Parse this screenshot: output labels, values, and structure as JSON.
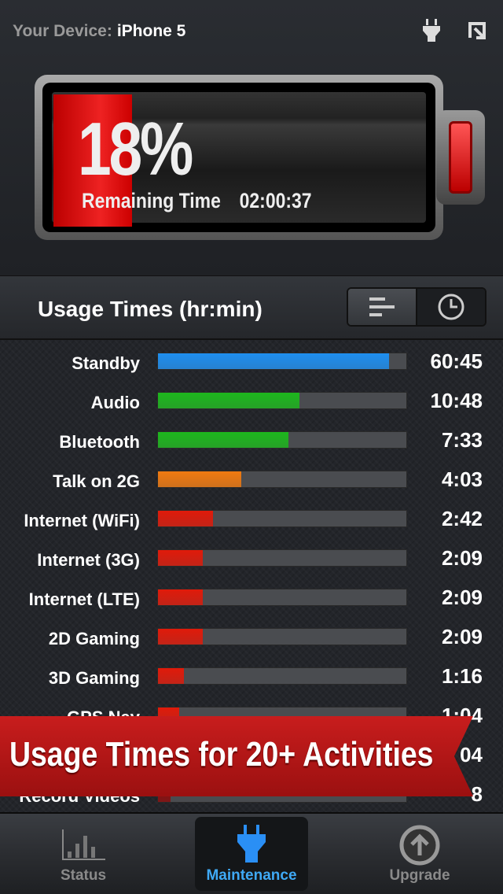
{
  "header": {
    "device_label": "Your Device:",
    "device_name": "iPhone 5"
  },
  "battery": {
    "percent_text": "18%",
    "percent": 18,
    "remaining_label": "Remaining Time",
    "remaining_value": "02:00:37",
    "color": "#e01818"
  },
  "usage": {
    "title": "Usage Times (hr:min)",
    "rows": [
      {
        "label": "Standby",
        "value": "60:45",
        "fill": 0.93,
        "color": "#1e8ff0"
      },
      {
        "label": "Audio",
        "value": "10:48",
        "fill": 0.57,
        "color": "#1db71d"
      },
      {
        "label": "Bluetooth",
        "value": "7:33",
        "fill": 0.525,
        "color": "#1db71d"
      },
      {
        "label": "Talk on 2G",
        "value": "4:03",
        "fill": 0.336,
        "color": "#f07a10"
      },
      {
        "label": "Internet (WiFi)",
        "value": "2:42",
        "fill": 0.223,
        "color": "#e01a0a"
      },
      {
        "label": "Internet (3G)",
        "value": "2:09",
        "fill": 0.18,
        "color": "#e01a0a"
      },
      {
        "label": "Internet (LTE)",
        "value": "2:09",
        "fill": 0.18,
        "color": "#e01a0a"
      },
      {
        "label": "2D Gaming",
        "value": "2:09",
        "fill": 0.18,
        "color": "#e01a0a"
      },
      {
        "label": "3D Gaming",
        "value": "1:16",
        "fill": 0.104,
        "color": "#e01a0a"
      },
      {
        "label": "GPS Nav",
        "value": "1:04",
        "fill": 0.085,
        "color": "#e01a0a"
      },
      {
        "label": "",
        "value": "04",
        "fill": 0.085,
        "color": "#e01a0a"
      },
      {
        "label": "Record Videos",
        "value": "8",
        "fill": 0.05,
        "color": "#8a0a0a"
      }
    ]
  },
  "banner": {
    "text": "Usage Times for 20+ Activities"
  },
  "tabs": [
    {
      "label": "Status"
    },
    {
      "label": "Maintenance",
      "active": true
    },
    {
      "label": "Upgrade"
    }
  ]
}
